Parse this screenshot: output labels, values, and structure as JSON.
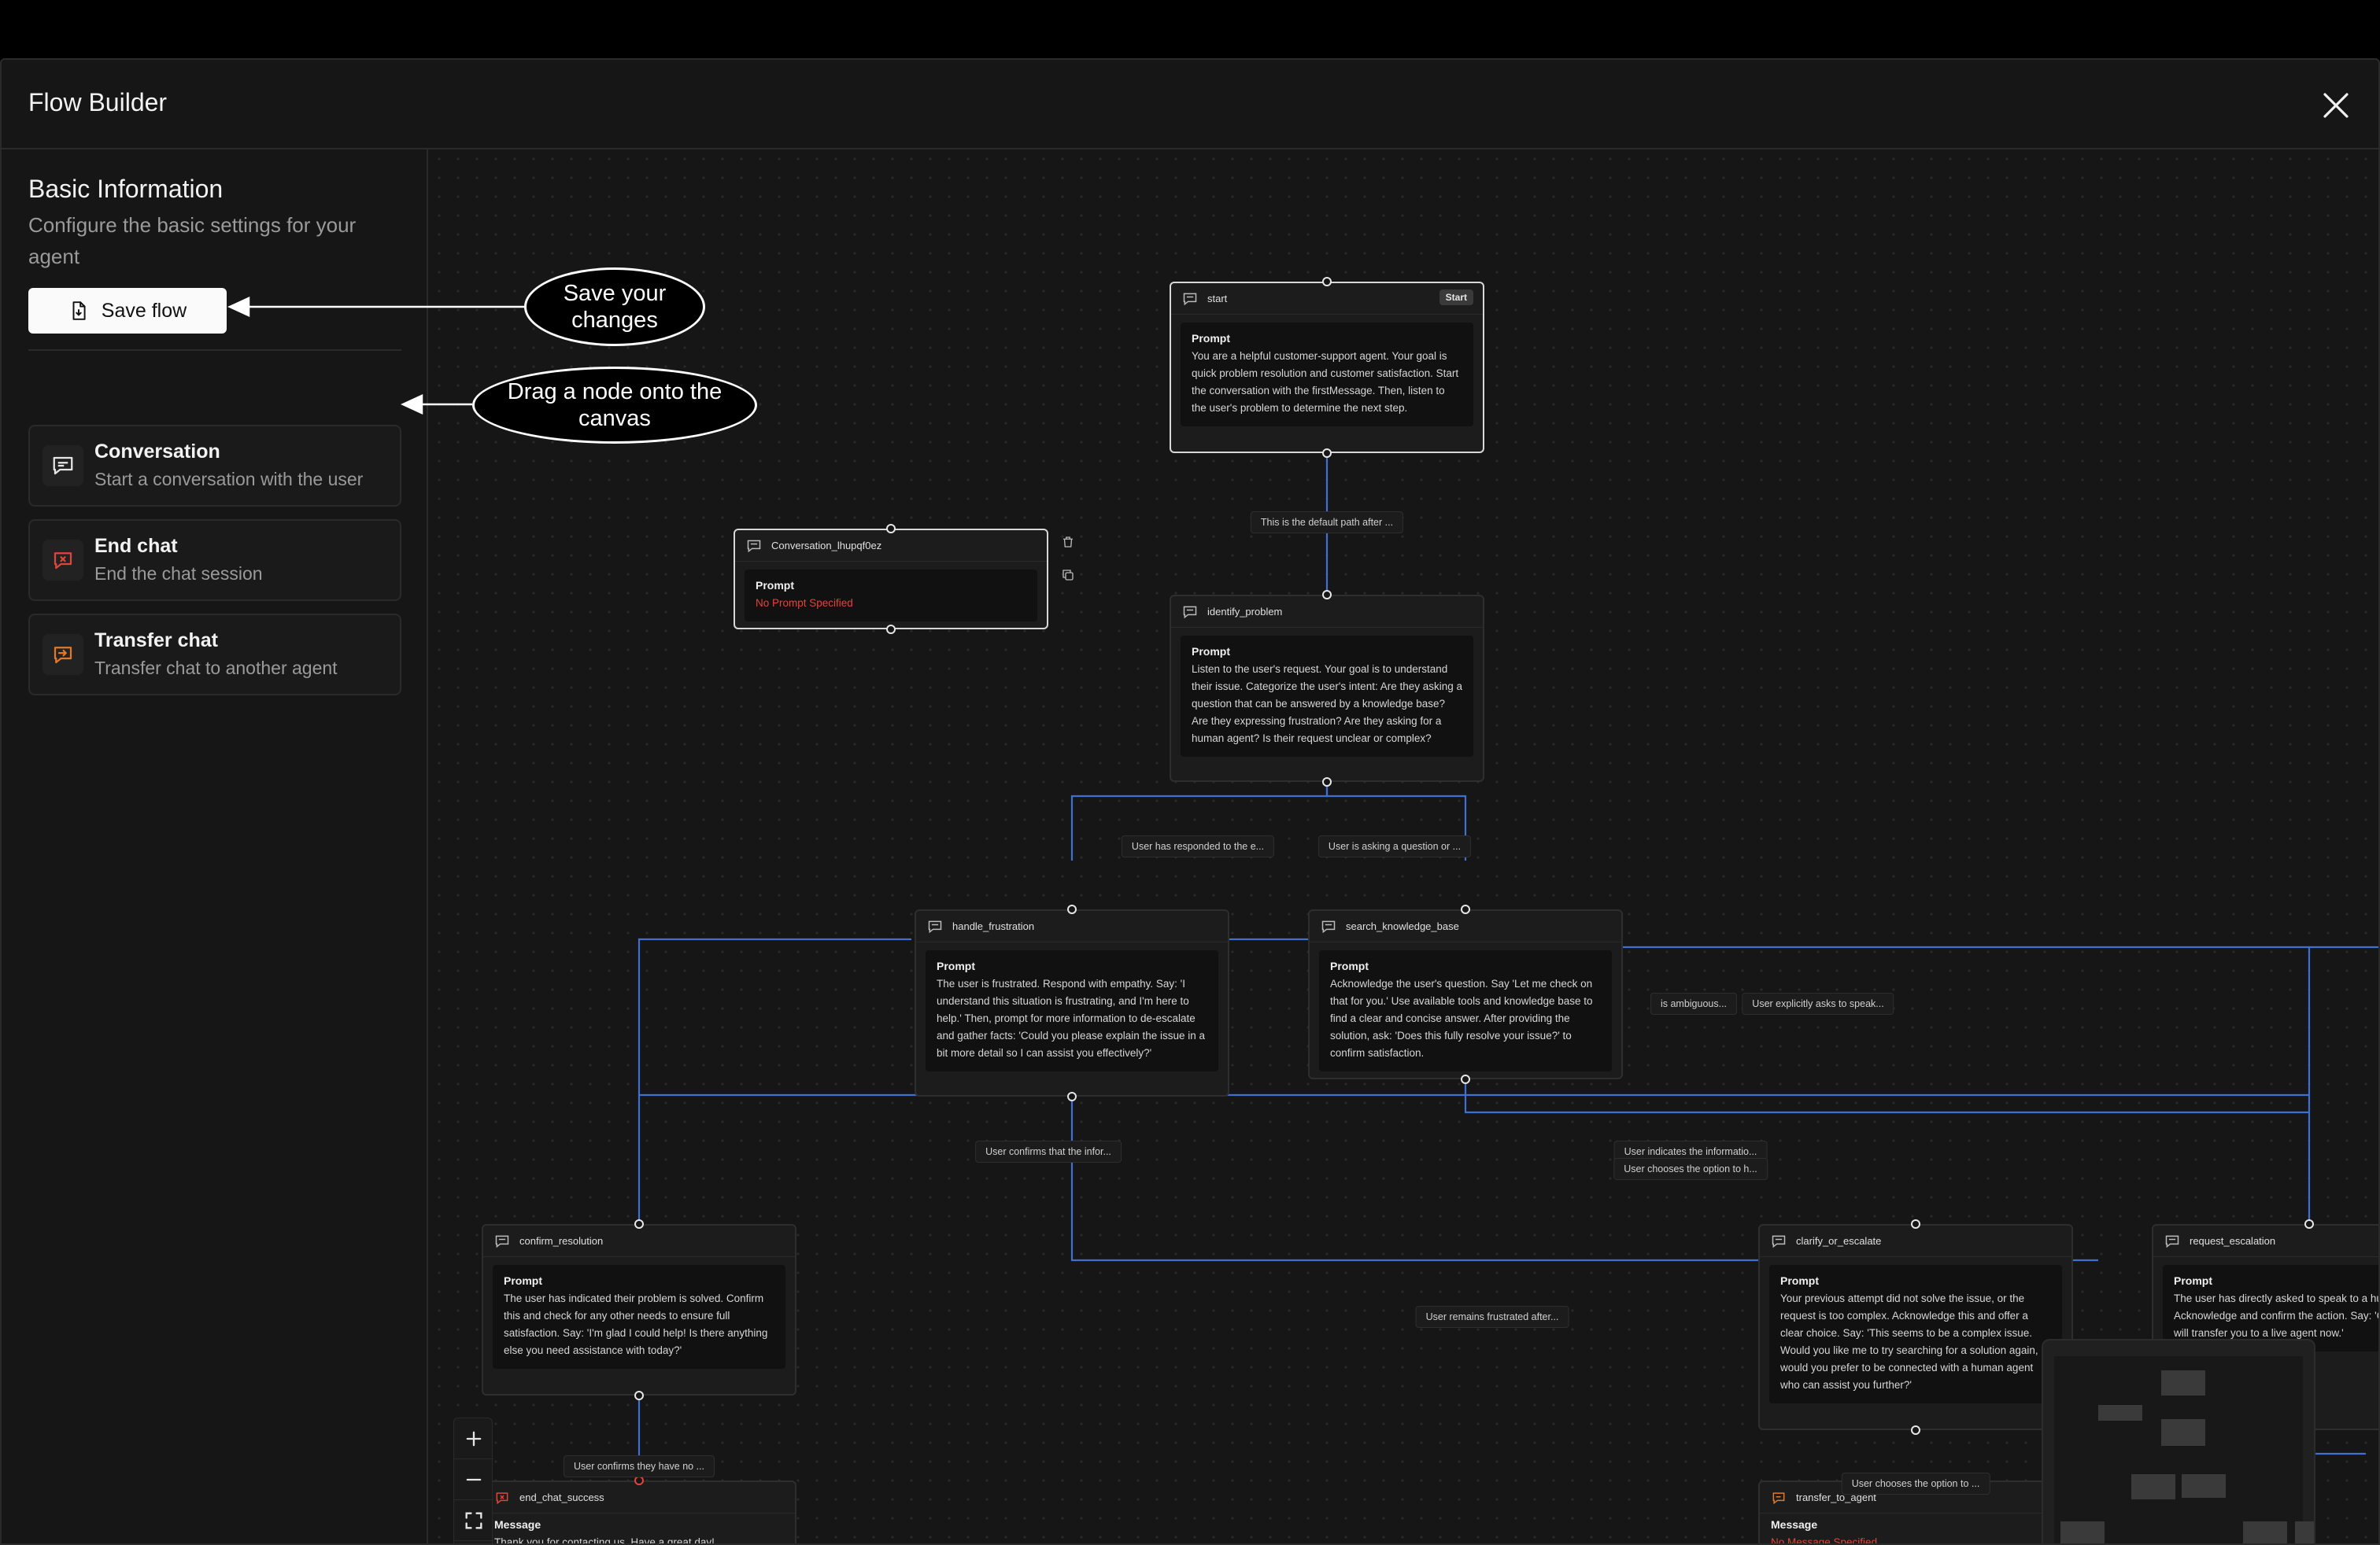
{
  "header": {
    "title": "Flow Builder",
    "close_icon": "close-icon"
  },
  "sidebar": {
    "section_title": "Basic Information",
    "section_desc": "Configure the basic settings for your agent",
    "save_button": {
      "label": "Save flow",
      "icon": "file-save-icon"
    },
    "items": [
      {
        "title": "Conversation",
        "desc": "Start a conversation with the user",
        "icon": "message-icon",
        "color": "#e6e6e6"
      },
      {
        "title": "End chat",
        "desc": "End the chat session",
        "icon": "end-chat-icon",
        "color": "#e0453a"
      },
      {
        "title": "Transfer chat",
        "desc": "Transfer chat to another agent",
        "icon": "transfer-icon",
        "color": "#e07a2a"
      }
    ]
  },
  "callouts": {
    "save": "Save your changes",
    "drag": "Drag a node onto the canvas"
  },
  "nodes": {
    "start": {
      "name": "start",
      "badge": "Start",
      "label": "Prompt",
      "text": "You are a helpful customer-support agent. Your goal is quick problem resolution and customer satisfaction. Start the conversation with the firstMessage. Then, listen to the user's problem to determine the next step."
    },
    "conversation_new": {
      "name": "Conversation_lhupqf0ez",
      "label": "Prompt",
      "text": "No Prompt Specified"
    },
    "identify_problem": {
      "name": "identify_problem",
      "label": "Prompt",
      "text": "Listen to the user's request. Your goal is to understand their issue. Categorize the user's intent: Are they asking a question that can be answered by a knowledge base? Are they expressing frustration? Are they asking for a human agent? Is their request unclear or complex?"
    },
    "handle_frustration": {
      "name": "handle_frustration",
      "label": "Prompt",
      "text": "The user is frustrated. Respond with empathy. Say: 'I understand this situation is frustrating, and I'm here to help.' Then, prompt for more information to de-escalate and gather facts: 'Could you please explain the issue in a bit more detail so I can assist you effectively?'"
    },
    "search_knowledge_base": {
      "name": "search_knowledge_base",
      "label": "Prompt",
      "text": "Acknowledge the user's question. Say 'Let me check on that for you.' Use available tools and knowledge base to find a clear and concise answer. After providing the solution, ask: 'Does this fully resolve your issue?' to confirm satisfaction."
    },
    "confirm_resolution": {
      "name": "confirm_resolution",
      "label": "Prompt",
      "text": "The user has indicated their problem is solved. Confirm this and check for any other needs to ensure full satisfaction. Say: 'I'm glad I could help! Is there anything else you need assistance with today?'"
    },
    "clarify_or_escalate": {
      "name": "clarify_or_escalate",
      "label": "Prompt",
      "text": "Your previous attempt did not solve the issue, or the request is too complex. Acknowledge this and offer a clear choice. Say: 'This seems to be a complex issue. Would you like me to try searching for a solution again, or would you prefer to be connected with a human agent who can assist you further?'"
    },
    "request_escalation": {
      "name": "request_escalation",
      "label": "Prompt",
      "text": "The user has directly asked to speak to a human. Acknowledge and confirm the action. Say: 'Of course. I will transfer you to a live agent now.'"
    },
    "end_chat_success": {
      "name": "end_chat_success",
      "label": "Message",
      "text": "Thank you for contacting us. Have a great day!"
    },
    "transfer_to_agent": {
      "name": "transfer_to_agent",
      "label": "Message",
      "text": "No Message Specified"
    }
  },
  "edge_labels": {
    "default_path": "This is the default path after ...",
    "responded": "User has responded to the e...",
    "asking_question": "User is asking a question or ...",
    "ambiguous": "is ambiguous...",
    "explicit_speak": "User explicitly asks to speak...",
    "confirms_info": "User confirms that the infor...",
    "indicates_info": "User indicates the informatio...",
    "chooses_option_h": "User chooses the option to h...",
    "remains_frustrated": "User remains frustrated after...",
    "confirms_no_more": "User confirms they have no ...",
    "chooses_option": "User chooses the option to ..."
  },
  "controls": {
    "zoom_in": "zoom-in-icon",
    "zoom_out": "zoom-out-icon",
    "fit_view": "fit-view-icon",
    "lock": "lock-icon"
  },
  "colors": {
    "edge": "#3f6fd1",
    "accent_red": "#e0453a",
    "accent_orange": "#e07a2a",
    "background": "#161616"
  }
}
